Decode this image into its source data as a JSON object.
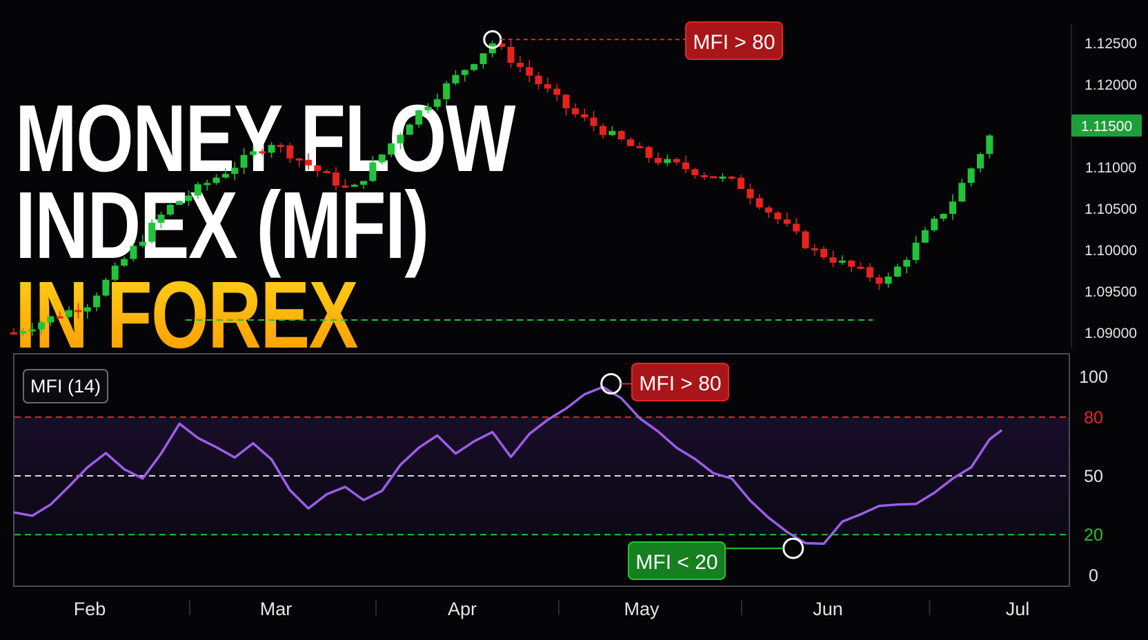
{
  "title": {
    "line1": "MONEY FLOW",
    "line2": "INDEX (MFI)",
    "line3": "IN FOREX"
  },
  "colors": {
    "bull": "#22c33a",
    "bear": "#e8221e",
    "mfi_line": "#9b5ee8",
    "overbought": "#e0282a",
    "oversold": "#22c33a",
    "midline": "#dcdcdc",
    "price_badge": "#1f9f3a",
    "gridline": "#2a2a30"
  },
  "chart_data": [
    {
      "type": "candlestick",
      "y_ticks": [
        "1.12500",
        "1.12000",
        "1.11500",
        "1.11000",
        "1.10500",
        "1.10000",
        "1.09500",
        "1.09000"
      ],
      "ylim": [
        1.0885,
        1.127
      ],
      "current_price": "1.11500",
      "support_level": 1.0915,
      "annotation": {
        "label": "MFI > 80",
        "price": 1.1254
      },
      "trend_path_days": [
        0,
        12,
        25,
        42,
        55,
        65,
        78,
        91,
        104,
        118,
        130,
        142,
        153,
        160
      ],
      "trend_path_close": [
        1.09,
        1.0935,
        1.105,
        1.113,
        1.107,
        1.116,
        1.125,
        1.1165,
        1.111,
        1.108,
        1.1,
        1.096,
        1.106,
        1.115
      ]
    },
    {
      "type": "line",
      "label": "MFI (14)",
      "y_ticks": [
        "100",
        "80",
        "50",
        "20",
        "0"
      ],
      "ylim": [
        0,
        100
      ],
      "levels": {
        "overbought": 80,
        "mid": 50,
        "oversold": 20
      },
      "series_days": [
        0,
        3,
        6,
        9,
        12,
        15,
        18,
        21,
        24,
        27,
        30,
        33,
        36,
        39,
        42,
        45,
        48,
        51,
        54,
        57,
        60,
        63,
        66,
        69,
        72,
        75,
        78,
        81,
        84,
        87,
        90,
        93,
        96,
        99,
        102,
        105,
        108,
        111,
        114,
        117,
        120,
        123,
        126,
        129,
        132,
        135,
        138,
        141,
        144,
        147,
        150,
        153,
        156,
        159,
        161
      ],
      "series_values": [
        32,
        29,
        36,
        44,
        55,
        61,
        54,
        48,
        62,
        76,
        70,
        64,
        60,
        66,
        59,
        42,
        34,
        40,
        45,
        37,
        43,
        55,
        65,
        70,
        62,
        67,
        73,
        59,
        72,
        78,
        85,
        91,
        96,
        89,
        80,
        72,
        65,
        58,
        52,
        48,
        38,
        28,
        22,
        15,
        16,
        26,
        31,
        34,
        36,
        35,
        42,
        48,
        55,
        68,
        74
      ],
      "annotations": [
        {
          "label": "MFI > 80",
          "day": 98,
          "value": 97
        },
        {
          "label": "MFI < 20",
          "day": 127,
          "value": 13
        }
      ]
    }
  ],
  "x_axis": {
    "months": [
      "Feb",
      "Mar",
      "Apr",
      "May",
      "Jun",
      "Jul"
    ],
    "month_days": [
      0,
      29,
      60,
      90,
      120,
      150
    ]
  }
}
